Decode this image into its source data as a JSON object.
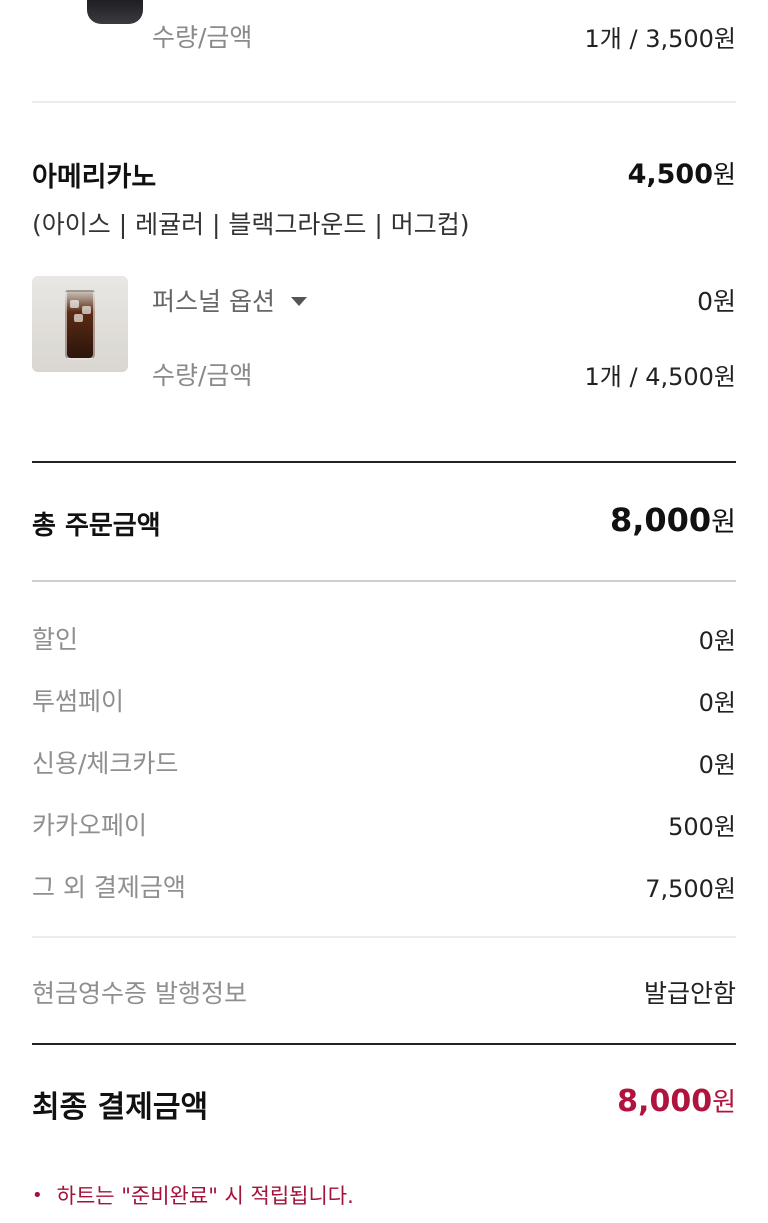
{
  "prev_item": {
    "qty_label": "수량/금액",
    "qty_value": "1개  / 3,500원"
  },
  "item": {
    "name": "아메리카노",
    "price_num": "4,500",
    "price_unit": "원",
    "options": "(아이스 | 레귤러 | 블랙그라운드 | 머그컵)",
    "personal_option_label": "퍼스널 옵션",
    "personal_option_value": "0원",
    "qty_label": "수량/금액",
    "qty_value": "1개  / 4,500원"
  },
  "total": {
    "label": "총 주문금액",
    "value_num": "8,000",
    "value_unit": "원"
  },
  "payments": [
    {
      "label": "할인",
      "value": "0원"
    },
    {
      "label": "투썸페이",
      "value": "0원"
    },
    {
      "label": "신용/체크카드",
      "value": "0원"
    },
    {
      "label": "카카오페이",
      "value": "500원"
    },
    {
      "label": "그 외 결제금액",
      "value": "7,500원"
    }
  ],
  "receipt": {
    "label": "현금영수증 발행정보",
    "value": "발급안함"
  },
  "final": {
    "label": "최종 결제금액",
    "value_num": "8,000",
    "value_unit": "원"
  },
  "note": {
    "bullet": "•",
    "text": "하트는 \"준비완료\" 시 적립됩니다."
  },
  "colors": {
    "accent": "#b0143e",
    "label_grey": "#8f8f8f",
    "divider": "#ececec"
  },
  "icons": {
    "dropdown": "caret-down-icon"
  }
}
